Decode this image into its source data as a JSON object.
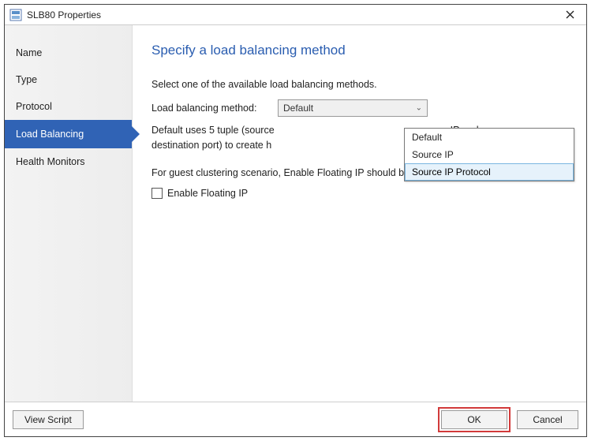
{
  "window": {
    "title": "SLB80 Properties"
  },
  "sidebar": {
    "items": [
      {
        "label": "Name"
      },
      {
        "label": "Type"
      },
      {
        "label": "Protocol"
      },
      {
        "label": "Load Balancing"
      },
      {
        "label": "Health Monitors"
      }
    ],
    "active_index": 3
  },
  "content": {
    "heading": "Specify a load balancing method",
    "intro": "Select one of the available load balancing methods.",
    "method_label": "Load balancing method:",
    "method_selected": "Default",
    "method_options": [
      "Default",
      "Source IP",
      "Source IP Protocol"
    ],
    "method_highlight_index": 2,
    "desc_part1": "Default uses 5 tuple (source",
    "desc_part2": "IP and",
    "desc_part3": "destination port) to create h",
    "guest_note": "For guest clustering scenario, Enable Floating IP should be set.",
    "floating_label": "Enable Floating IP",
    "floating_checked": false
  },
  "footer": {
    "view_script": "View Script",
    "ok": "OK",
    "cancel": "Cancel"
  }
}
